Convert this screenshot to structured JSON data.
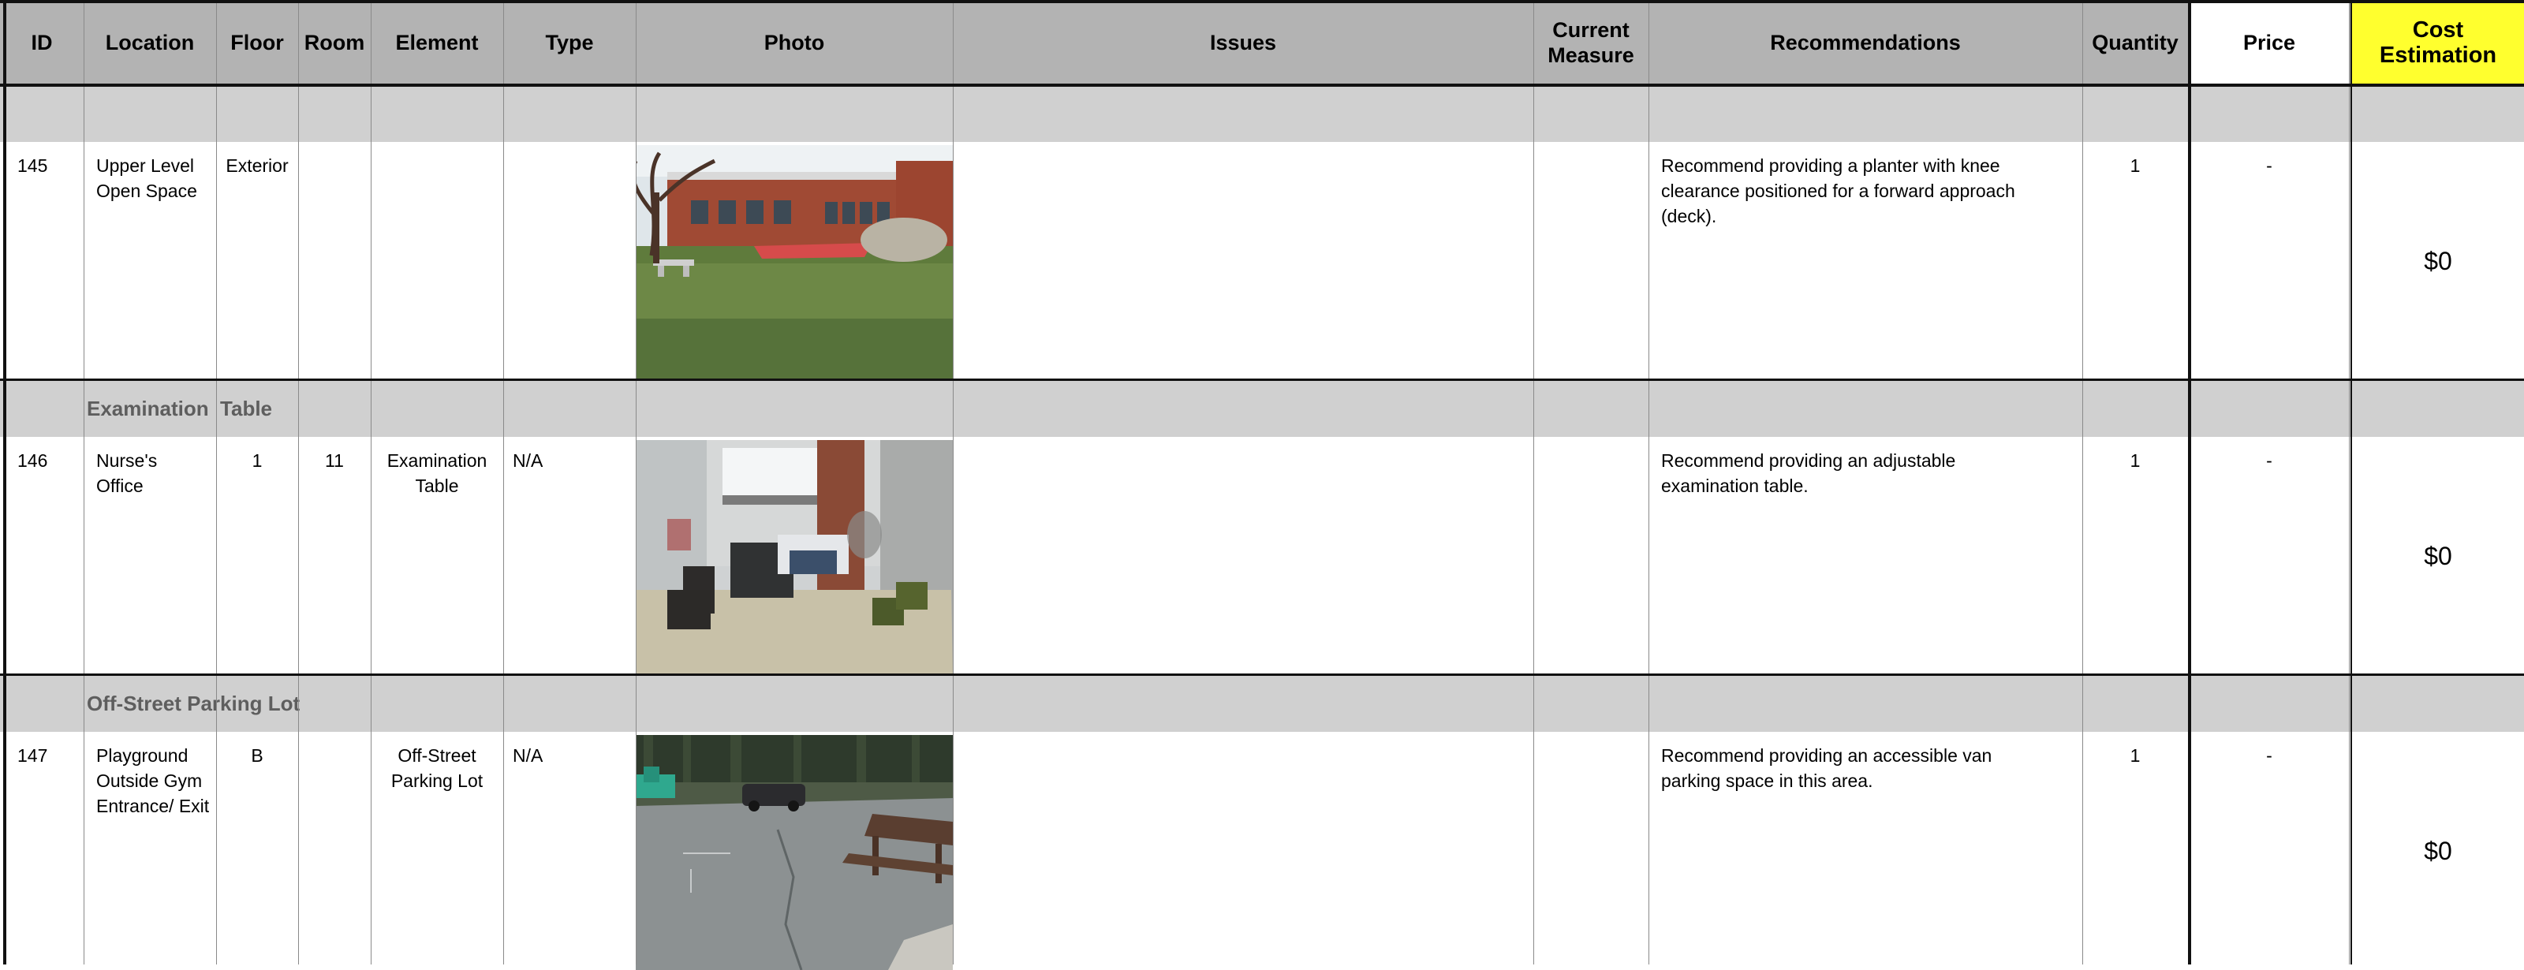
{
  "headers": {
    "id": "ID",
    "location": "Location",
    "floor": "Floor",
    "room": "Room",
    "element": "Element",
    "type": "Type",
    "photo": "Photo",
    "issues": "Issues",
    "current_measure": "Current Measure",
    "recommendations": "Recommendations",
    "quantity": "Quantity",
    "price": "Price",
    "cost_estimation": "Cost Estimation"
  },
  "groups": [
    {
      "label": ""
    },
    {
      "label": "Examination  Table"
    },
    {
      "label": "Off-Street Parking Lot"
    }
  ],
  "rows": [
    {
      "id": "145",
      "location": "Upper Level Open Space",
      "floor": "Exterior",
      "room": "",
      "element": "",
      "type": "",
      "photo_icon": "photo-school-courtyard",
      "issues": "",
      "current_measure": "",
      "recommendation": "Recommend providing a planter with knee clearance positioned for a forward approach (deck).",
      "quantity": "1",
      "price": "-",
      "cost": "$0"
    },
    {
      "id": "146",
      "location": "Nurse's Office",
      "floor": "1",
      "room": "11",
      "element": "Examination Table",
      "type": "N/A",
      "photo_icon": "photo-nurse-office",
      "issues": "",
      "current_measure": "",
      "recommendation": "Recommend providing an adjustable examination table.",
      "quantity": "1",
      "price": "-",
      "cost": "$0"
    },
    {
      "id": "147",
      "location": "Playground Outside Gym Entrance/ Exit",
      "floor": "B",
      "room": "",
      "element": "Off-Street Parking Lot",
      "type": "N/A",
      "photo_icon": "photo-parking-lot",
      "issues": "",
      "current_measure": "",
      "recommendation": "Recommend providing an accessible van parking space in this area.",
      "quantity": "1",
      "price": "-",
      "cost": "$0"
    }
  ],
  "colors": {
    "header_bg": "#b3b3b3",
    "group_bg": "#d0d0d0",
    "cost_header_bg": "#ffff2e",
    "group_text": "#5e5e5e"
  }
}
